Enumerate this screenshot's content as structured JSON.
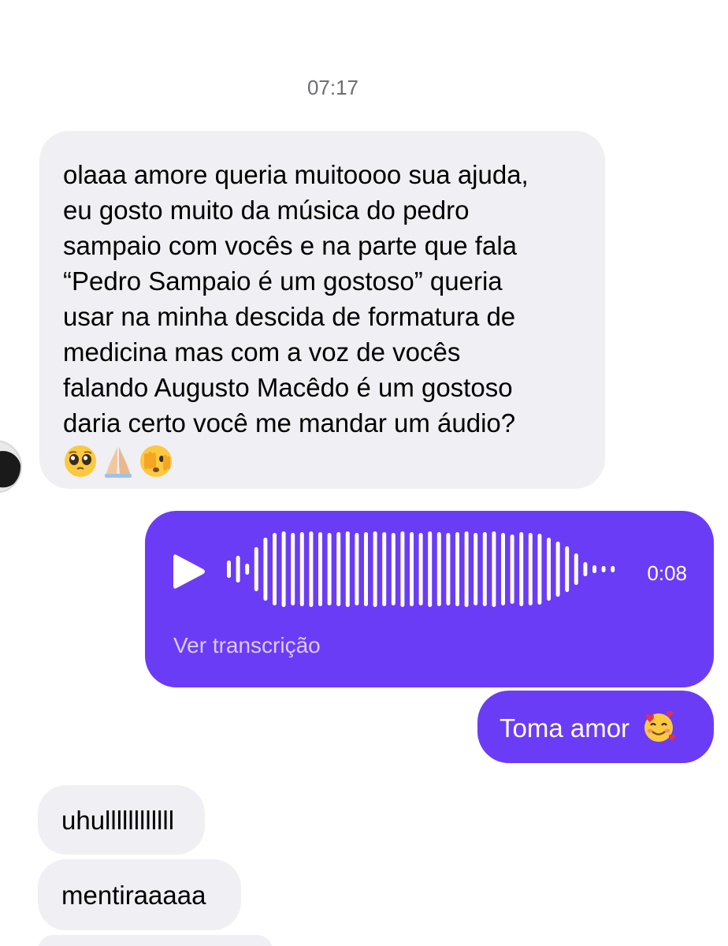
{
  "conversation": {
    "timestamp": "07:17",
    "messages": [
      {
        "direction": "incoming",
        "type": "text",
        "lines": [
          "olaaa amore queria muitoooo sua ajuda,",
          "eu gosto muito da música do pedro",
          "sampaio com vocês e na parte que fala",
          "“Pedro Sampaio é um gostoso” queria",
          "usar na minha descida de formatura de",
          "medicina mas com a voz de vocês",
          "falando Augusto Macêdo é um gostoso",
          "daria certo você me mandar um áudio?"
        ],
        "emojis": [
          "pleading-face-emoji",
          "folded-hands-emoji",
          "face-peeking-emoji"
        ]
      },
      {
        "direction": "outgoing",
        "type": "audio",
        "duration": "0:08",
        "transcription_link": "Ver transcrição"
      },
      {
        "direction": "outgoing",
        "type": "text",
        "text": "Toma amor",
        "emoji": "smiling-face-with-hearts-emoji"
      },
      {
        "direction": "incoming",
        "type": "text",
        "text": "uhullllllllllll"
      },
      {
        "direction": "incoming",
        "type": "text",
        "text": "mentiraaaaa"
      }
    ]
  },
  "colors": {
    "outgoing_bubble": "#6b3cf6",
    "incoming_bubble": "#efeff4",
    "timestamp_text": "#6d6d72",
    "transcription_link": "#d9ccff"
  },
  "icons": {
    "play": "play-icon",
    "waveform": "audio-waveform",
    "avatar": "contact-avatar"
  }
}
